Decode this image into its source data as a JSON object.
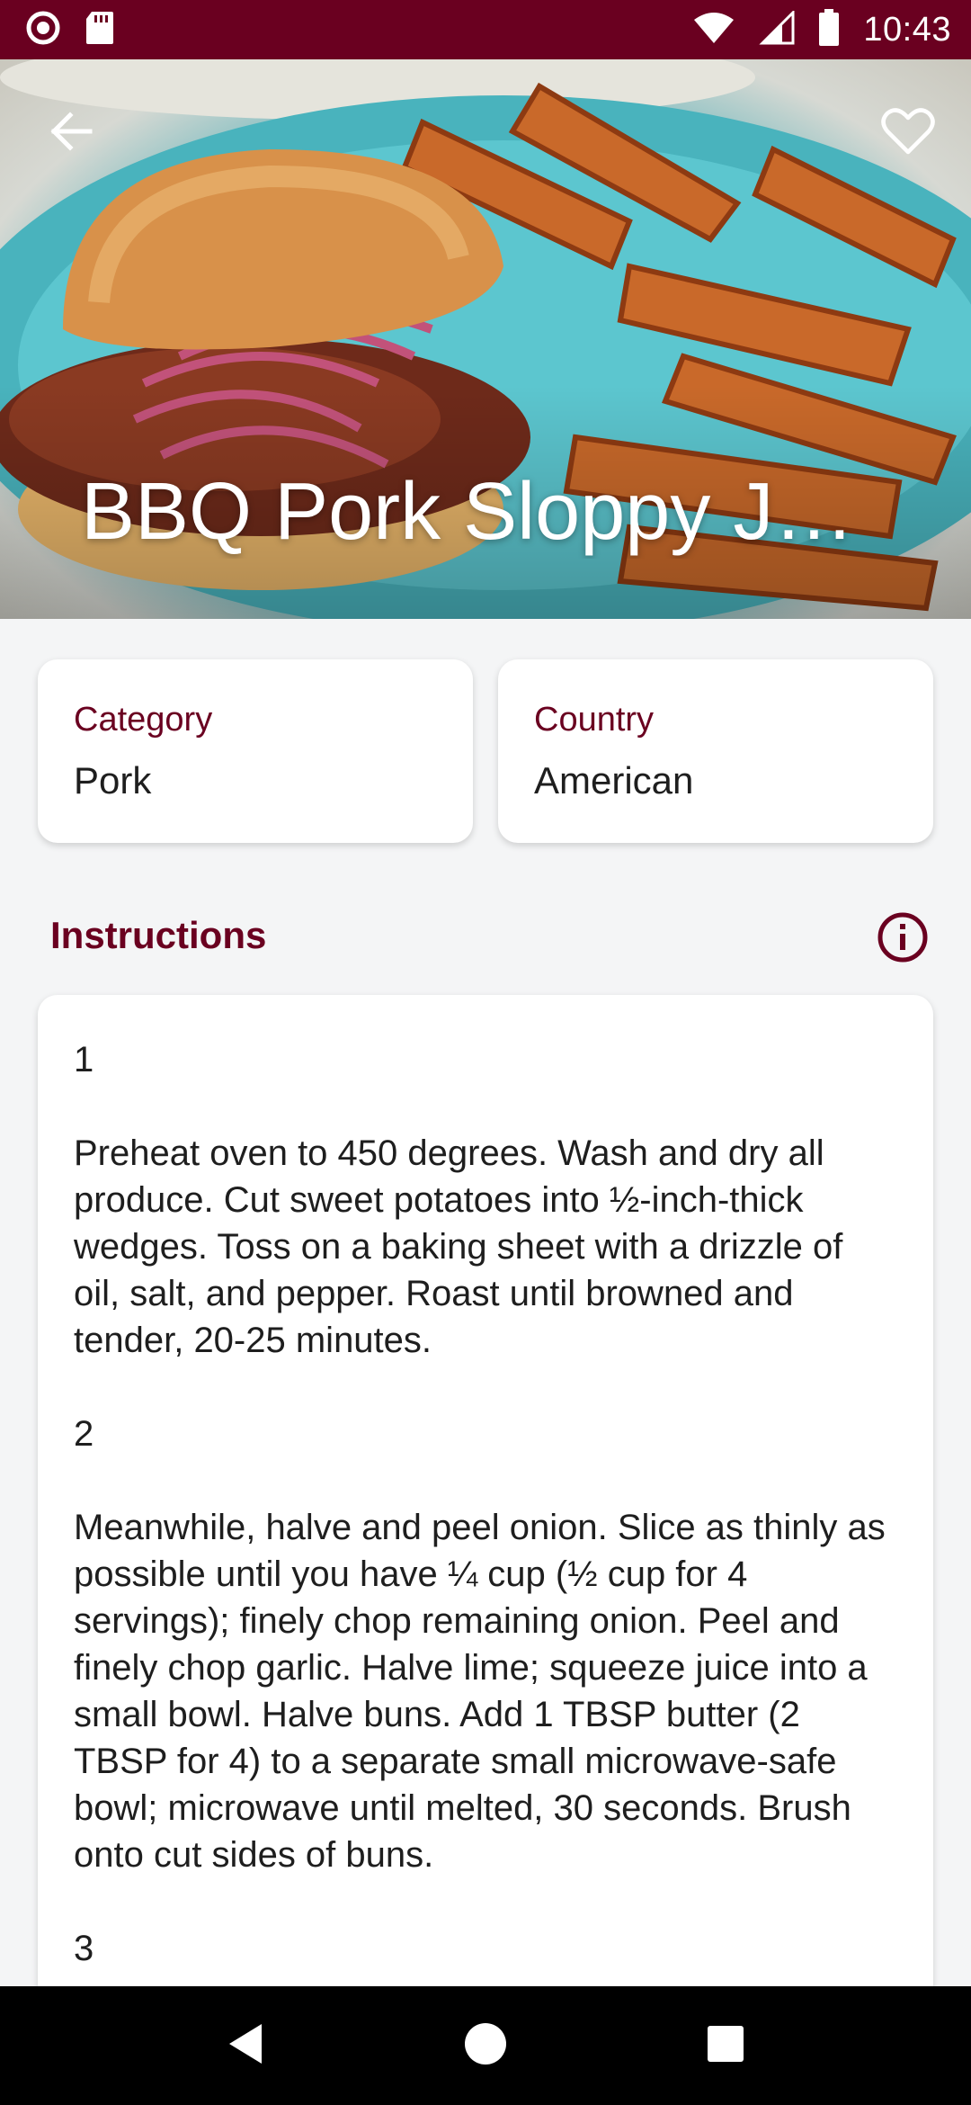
{
  "status_bar": {
    "time": "10:43",
    "icons": [
      "record-icon",
      "sd-card-icon",
      "wifi-icon",
      "signal-icon",
      "battery-icon"
    ]
  },
  "hero": {
    "title": "BBQ Pork Sloppy Joes",
    "back_icon": "arrow-back-icon",
    "favorite_icon": "heart-outline-icon"
  },
  "info": {
    "category_label": "Category",
    "category_value": "Pork",
    "country_label": "Country",
    "country_value": "American"
  },
  "instructions": {
    "title": "Instructions",
    "info_icon": "info-icon",
    "text": "1\n\nPreheat oven to 450 degrees. Wash and dry all produce. Cut sweet potatoes into ½-inch-thick wedges. Toss on a baking sheet with a drizzle of oil, salt, and pepper. Roast until browned and tender, 20-25 minutes.\n\n2\n\nMeanwhile, halve and peel onion. Slice as thinly as possible until you have ¼ cup (½ cup for 4 servings); finely chop remaining onion. Peel and finely chop garlic. Halve lime; squeeze juice into a small bowl. Halve buns. Add 1 TBSP butter (2 TBSP for 4) to a separate small microwave-safe bowl; microwave until melted, 30 seconds. Brush onto cut sides of buns.\n\n3"
  },
  "nav_bar": {
    "icons": [
      "back-triangle-icon",
      "home-circle-icon",
      "recents-square-icon"
    ]
  },
  "colors": {
    "primary": "#6a0020",
    "background": "#f4f5f6",
    "card": "#ffffff"
  }
}
